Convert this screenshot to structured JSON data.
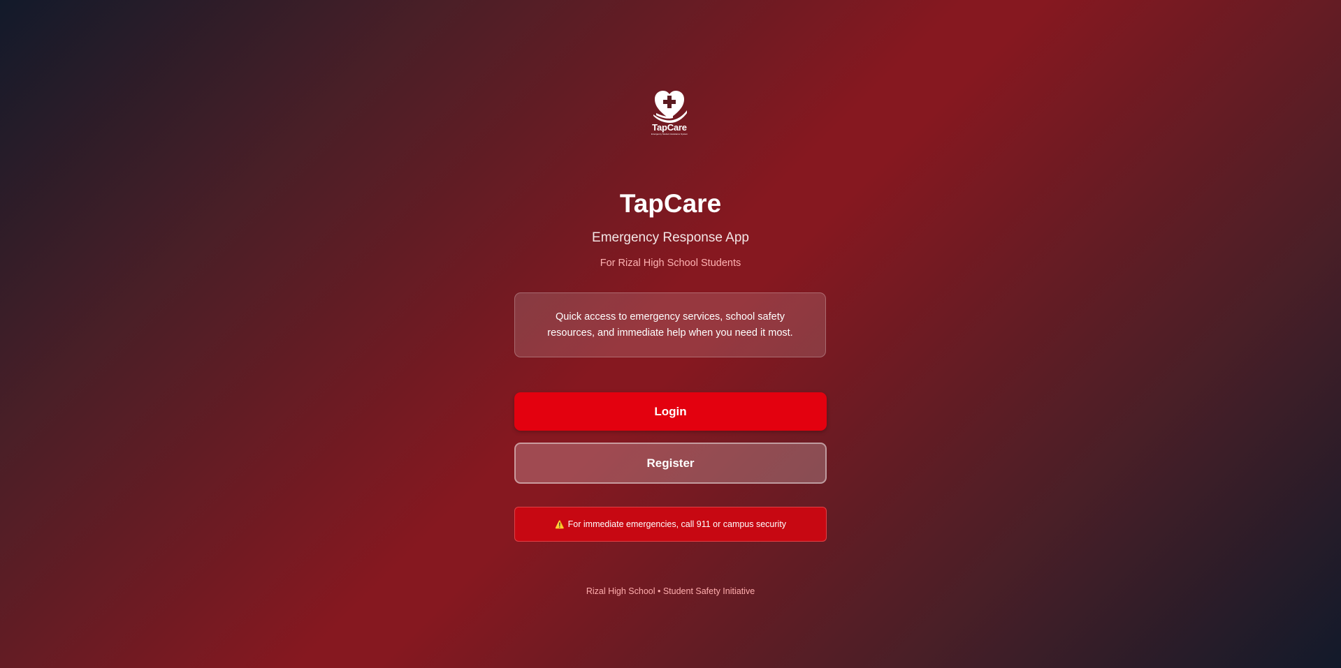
{
  "logo": {
    "word": "TapCare",
    "tagline": "Emergency Student Assistance System",
    "icon": "heart-cross-hand-icon"
  },
  "header": {
    "title": "TapCare",
    "subtitle": "Emergency Response App",
    "school": "For Rizal High School Students"
  },
  "info": {
    "text": "Quick access to emergency services, school safety resources, and immediate help when you need it most."
  },
  "actions": {
    "login_label": "Login",
    "register_label": "Register"
  },
  "alert": {
    "icon": "⚠️",
    "text": "For immediate emergencies, call 911 or campus security"
  },
  "footer": {
    "text": "Rizal High School • Student Safety Initiative"
  },
  "colors": {
    "primary": "#e3010f",
    "alert": "#c70812",
    "background_center": "#861820",
    "background_corner": "#121a2a"
  }
}
